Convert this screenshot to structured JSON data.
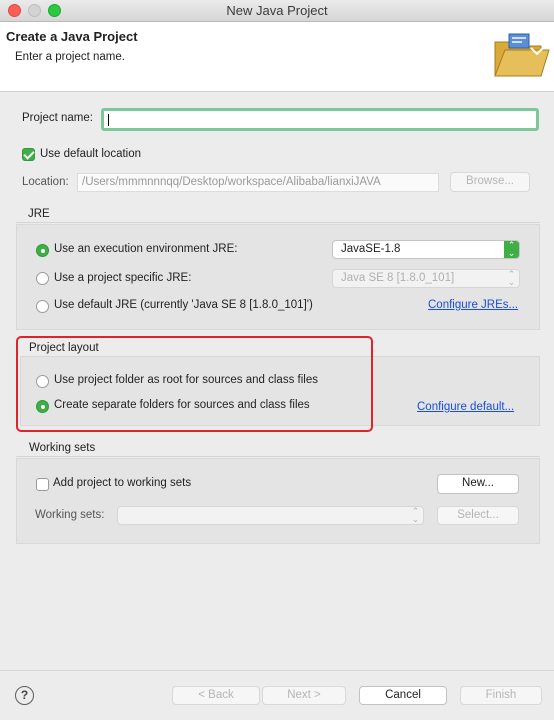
{
  "window": {
    "title": "New Java Project"
  },
  "header": {
    "title": "Create a Java Project",
    "subtitle": "Enter a project name."
  },
  "project": {
    "name_label": "Project name:",
    "name_value": "",
    "use_default_location_label": "Use default location",
    "use_default_location_checked": true,
    "location_label": "Location:",
    "location_value": "/Users/mmmnnnqq/Desktop/workspace/Alibaba/lianxiJAVA",
    "browse_label": "Browse..."
  },
  "jre": {
    "title": "JRE",
    "options": [
      {
        "label": "Use an execution environment JRE:",
        "selected": true
      },
      {
        "label": "Use a project specific JRE:",
        "selected": false
      },
      {
        "label": "Use default JRE (currently 'Java SE 8 [1.8.0_101]')",
        "selected": false
      }
    ],
    "environment_select": "JavaSE-1.8",
    "project_jre_select": "Java SE 8 [1.8.0_101]",
    "configure_link": "Configure JREs..."
  },
  "layout": {
    "title": "Project layout",
    "options": [
      {
        "label": "Use project folder as root for sources and class files",
        "selected": false
      },
      {
        "label": "Create separate folders for sources and class files",
        "selected": true
      }
    ],
    "configure_link": "Configure default..."
  },
  "working_sets": {
    "title": "Working sets",
    "add_label": "Add project to working sets",
    "add_checked": false,
    "new_label": "New...",
    "sets_label": "Working sets:",
    "sets_value": "",
    "select_label": "Select..."
  },
  "footer": {
    "back_label": "< Back",
    "next_label": "Next >",
    "cancel_label": "Cancel",
    "finish_label": "Finish"
  },
  "colors": {
    "accent": "#3fae47",
    "link": "#1a4ed8",
    "highlight": "#e0232a",
    "focus_ring": "#7bc79a"
  },
  "icons": [
    "folder-icon",
    "help-icon",
    "chevron-updown-icon"
  ]
}
